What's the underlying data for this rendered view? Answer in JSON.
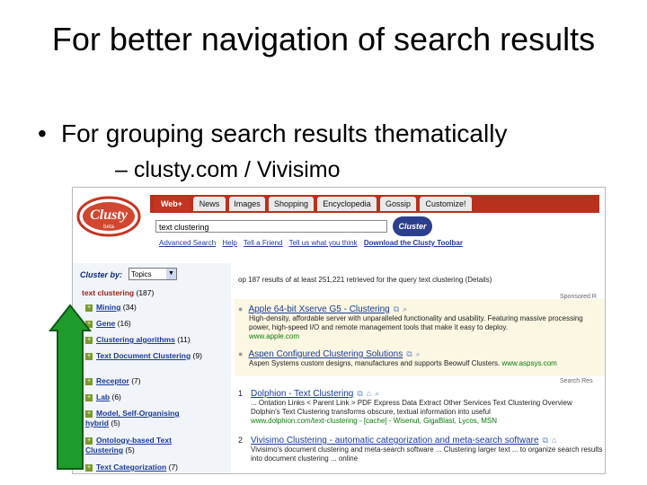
{
  "slide": {
    "title": "For better navigation of search results",
    "bullet": "For grouping search results thematically",
    "sub": "– clusty.com / Vivisimo"
  },
  "browser": {
    "logo_text": "Clusty",
    "logo_sub": "beta",
    "tabs": [
      "Web+",
      "News",
      "Images",
      "Shopping",
      "Encyclopedia",
      "Gossip",
      "Customize!"
    ],
    "search_value": "text clustering",
    "cluster_button": "Cluster",
    "links": [
      "Advanced Search",
      "Help",
      "Tell a Friend",
      "Tell us what you think",
      "Download the Clusty Toolbar"
    ]
  },
  "sidebar": {
    "cluster_by_label": "Cluster by:",
    "cluster_by_value": "Topics",
    "root_label": "text clustering",
    "root_count": "(187)",
    "items": [
      {
        "label": "Mining",
        "count": "(34)"
      },
      {
        "label": "Gene",
        "count": "(16)"
      },
      {
        "label": "Clustering algorithms",
        "count": "(11)"
      },
      {
        "label": "Text Document Clustering",
        "count": "(9)"
      },
      {
        "label": "Receptor",
        "count": "(7)"
      },
      {
        "label": "Lab",
        "count": "(6)"
      },
      {
        "label": "Model, Self-Organising hybrid",
        "count": "(5)"
      },
      {
        "label": "Ontology-based Text Clustering",
        "count": "(5)"
      },
      {
        "label": "Text Categorization",
        "count": "(7)"
      }
    ]
  },
  "results": {
    "query_line": "op 187 results of at least 251,221 retrieved for the query text clustering (Details)",
    "sponsored": "Sponsored R",
    "ads": [
      {
        "title": "Apple 64-bit Xserve G5 - Clustering",
        "desc": "High-density, affordable server with unparalleled functionality and usability. Featuring massive processing power, high-speed I/O and remote management tools that make it easy to deploy.",
        "url": "www.apple.com"
      },
      {
        "title": "Aspen Configured Clustering Solutions",
        "desc": "Aspen Systems custom designs, manufactures and supports Beowulf Clusters.",
        "url": "www.aspsys.com"
      }
    ],
    "search_results_label": "Search Res",
    "organic": [
      {
        "num": "1",
        "title": "Dolphion - Text Clustering",
        "desc": "... Ontation Links < Parent Link > PDF Express Data Extract Other Services Text Clustering Overview Dolphin's Text Clustering transforms obscure, textual information into useful",
        "url": "www.dolphion.com/text-clustering - [cache] - Wisenut, GigaBlast, Lycos, MSN"
      },
      {
        "num": "2",
        "title": "Vivisimo Clustering - automatic categorization and meta-search software",
        "desc": "Vivisimo's document clustering and meta-search software ... Clustering larger text ... to organize search results into document clustering ... online",
        "url": ""
      }
    ]
  }
}
